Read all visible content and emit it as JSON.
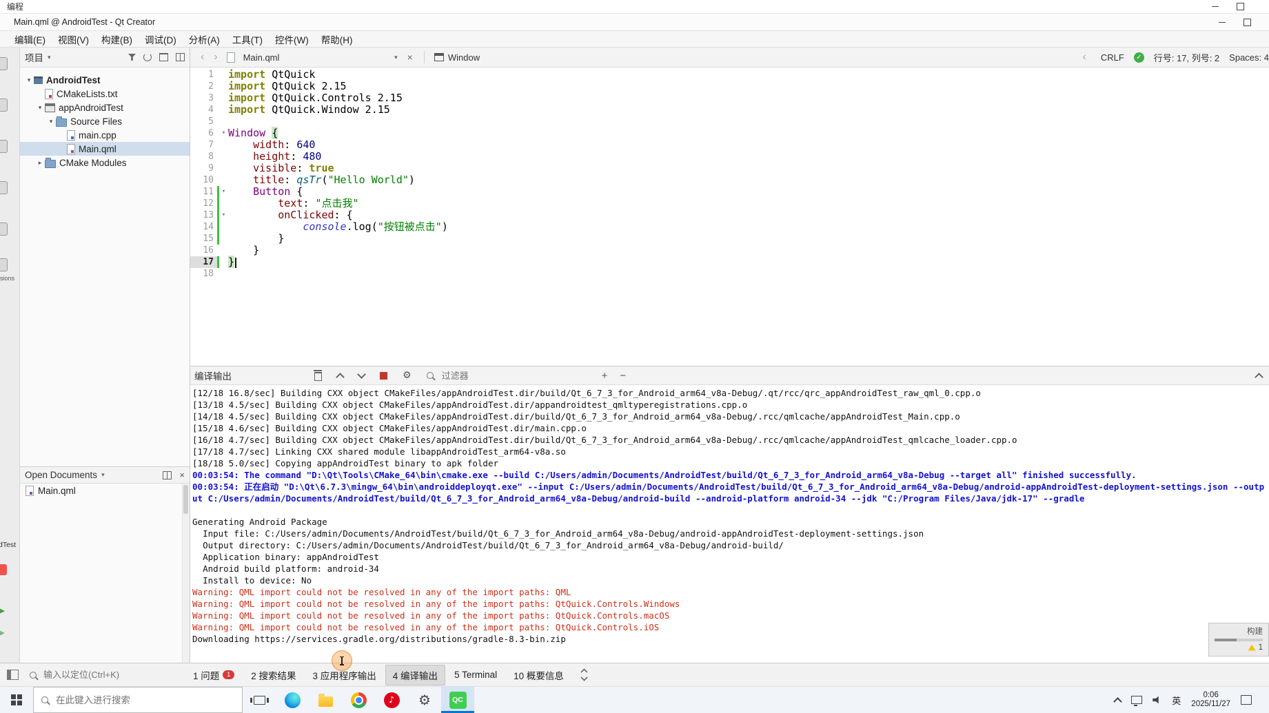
{
  "window": {
    "outer_title": "编程",
    "title": "Main.qml @ AndroidTest - Qt Creator"
  },
  "menu_bar": [
    "编辑(E)",
    "视图(V)",
    "构建(B)",
    "调试(D)",
    "分析(A)",
    "工具(T)",
    "控件(W)",
    "帮助(H)"
  ],
  "mode_strip": {
    "extensions_fragment": "sions",
    "kit_fragment": "dTest"
  },
  "project_pane": {
    "header": "项目",
    "tree": [
      {
        "label": "AndroidTest",
        "depth": 0,
        "expander": "v",
        "icon": "project",
        "bold": true
      },
      {
        "label": "CMakeLists.txt",
        "depth": 1,
        "expander": "",
        "icon": "cmake-file"
      },
      {
        "label": "appAndroidTest",
        "depth": 1,
        "expander": "v",
        "icon": "app"
      },
      {
        "label": "Source Files",
        "depth": 2,
        "expander": "v",
        "icon": "folder"
      },
      {
        "label": "main.cpp",
        "depth": 3,
        "expander": "",
        "icon": "cpp-file"
      },
      {
        "label": "Main.qml",
        "depth": 3,
        "expander": "",
        "icon": "qml-file",
        "selected": true
      },
      {
        "label": "CMake Modules",
        "depth": 1,
        "expander": ">",
        "icon": "folder"
      }
    ],
    "open_documents": {
      "header": "Open Documents",
      "items": [
        "Main.qml"
      ]
    }
  },
  "editor": {
    "nav": {
      "tab_label": "Main.qml",
      "context_label": "Window"
    },
    "status": {
      "line_ending": "CRLF",
      "cursor_position": "行号: 17, 列号: 2",
      "indent": "Spaces: 4"
    },
    "code": {
      "lines": [
        {
          "n": 1,
          "t": [
            [
              "kw",
              "import"
            ],
            [
              "pl",
              " QtQuick"
            ]
          ]
        },
        {
          "n": 2,
          "t": [
            [
              "kw",
              "import"
            ],
            [
              "pl",
              " QtQuick 2.15"
            ]
          ]
        },
        {
          "n": 3,
          "t": [
            [
              "kw",
              "import"
            ],
            [
              "pl",
              " QtQuick.Controls 2.15"
            ]
          ]
        },
        {
          "n": 4,
          "t": [
            [
              "kw",
              "import"
            ],
            [
              "pl",
              " QtQuick.Window 2.15"
            ]
          ]
        },
        {
          "n": 5,
          "t": []
        },
        {
          "n": 6,
          "t": [
            [
              "ty",
              "Window"
            ],
            [
              "pl",
              " "
            ],
            [
              "mb",
              "{"
            ]
          ],
          "fold": true
        },
        {
          "n": 7,
          "t": [
            [
              "pl",
              "    "
            ],
            [
              "pr",
              "width"
            ],
            [
              "pl",
              ": "
            ],
            [
              "nu",
              "640"
            ]
          ]
        },
        {
          "n": 8,
          "t": [
            [
              "pl",
              "    "
            ],
            [
              "pr",
              "height"
            ],
            [
              "pl",
              ": "
            ],
            [
              "nu",
              "480"
            ]
          ]
        },
        {
          "n": 9,
          "t": [
            [
              "pl",
              "    "
            ],
            [
              "pr",
              "visible"
            ],
            [
              "pl",
              ": "
            ],
            [
              "kw",
              "true"
            ]
          ]
        },
        {
          "n": 10,
          "t": [
            [
              "pl",
              "    "
            ],
            [
              "pr",
              "title"
            ],
            [
              "pl",
              ": "
            ],
            [
              "fn",
              "qsTr"
            ],
            [
              "pl",
              "("
            ],
            [
              "st",
              "\"Hello World\""
            ],
            [
              "pl",
              ")"
            ]
          ]
        },
        {
          "n": 11,
          "t": [
            [
              "pl",
              "    "
            ],
            [
              "ty",
              "Button"
            ],
            [
              "pl",
              " {"
            ]
          ],
          "fold": true,
          "chg": true
        },
        {
          "n": 12,
          "t": [
            [
              "pl",
              "        "
            ],
            [
              "pr",
              "text"
            ],
            [
              "pl",
              ": "
            ],
            [
              "st",
              "\"点击我\""
            ]
          ],
          "chg": true
        },
        {
          "n": 13,
          "t": [
            [
              "pl",
              "        "
            ],
            [
              "pr",
              "onClicked"
            ],
            [
              "pl",
              ": {"
            ]
          ],
          "fold": true,
          "chg": true
        },
        {
          "n": 14,
          "t": [
            [
              "pl",
              "            "
            ],
            [
              "vi",
              "console"
            ],
            [
              "pl",
              ".log("
            ],
            [
              "st",
              "\"按钮被点击\""
            ],
            [
              "pl",
              ")"
            ]
          ],
          "chg": true
        },
        {
          "n": 15,
          "t": [
            [
              "pl",
              "        }"
            ]
          ],
          "chg": true
        },
        {
          "n": 16,
          "t": [
            [
              "pl",
              "    }"
            ]
          ]
        },
        {
          "n": 17,
          "t": [
            [
              "mb",
              "}"
            ]
          ],
          "chg": true,
          "cur": true
        },
        {
          "n": 18,
          "t": []
        }
      ]
    }
  },
  "output_pane": {
    "title": "编译输出",
    "filter_placeholder": "过滤器",
    "lines": [
      {
        "c": "std",
        "t": "[12/18 16.8/sec] Building CXX object CMakeFiles/appAndroidTest.dir/build/Qt_6_7_3_for_Android_arm64_v8a-Debug/.qt/rcc/qrc_appAndroidTest_raw_qml_0.cpp.o"
      },
      {
        "c": "std",
        "t": "[13/18 4.5/sec] Building CXX object CMakeFiles/appAndroidTest.dir/appandroidtest_qmltyperegistrations.cpp.o"
      },
      {
        "c": "std",
        "t": "[14/18 4.5/sec] Building CXX object CMakeFiles/appAndroidTest.dir/build/Qt_6_7_3_for_Android_arm64_v8a-Debug/.rcc/qmlcache/appAndroidTest_Main.cpp.o"
      },
      {
        "c": "std",
        "t": "[15/18 4.6/sec] Building CXX object CMakeFiles/appAndroidTest.dir/main.cpp.o"
      },
      {
        "c": "std",
        "t": "[16/18 4.7/sec] Building CXX object CMakeFiles/appAndroidTest.dir/build/Qt_6_7_3_for_Android_arm64_v8a-Debug/.rcc/qmlcache/appAndroidTest_qmlcache_loader.cpp.o"
      },
      {
        "c": "std",
        "t": "[17/18 4.7/sec] Linking CXX shared module libappAndroidTest_arm64-v8a.so"
      },
      {
        "c": "std",
        "t": "[18/18 5.0/sec] Copying appAndroidTest binary to apk folder"
      },
      {
        "c": "msg",
        "t": "00:03:54: The command \"D:\\Qt\\Tools\\CMake_64\\bin\\cmake.exe --build C:/Users/admin/Documents/AndroidTest/build/Qt_6_7_3_for_Android_arm64_v8a-Debug --target all\" finished successfully."
      },
      {
        "c": "msg",
        "t": "00:03:54: 正在启动 \"D:\\Qt\\6.7.3\\mingw_64\\bin\\androiddeployqt.exe\" --input C:/Users/admin/Documents/AndroidTest/build/Qt_6_7_3_for_Android_arm64_v8a-Debug/android-appAndroidTest-deployment-settings.json --output C:/Users/admin/Documents/AndroidTest/build/Qt_6_7_3_for_Android_arm64_v8a-Debug/android-build --android-platform android-34 --jdk \"C:/Program Files/Java/jdk-17\" --gradle"
      },
      {
        "c": "std",
        "t": ""
      },
      {
        "c": "std",
        "t": "Generating Android Package"
      },
      {
        "c": "std",
        "t": "  Input file: C:/Users/admin/Documents/AndroidTest/build/Qt_6_7_3_for_Android_arm64_v8a-Debug/android-appAndroidTest-deployment-settings.json"
      },
      {
        "c": "std",
        "t": "  Output directory: C:/Users/admin/Documents/AndroidTest/build/Qt_6_7_3_for_Android_arm64_v8a-Debug/android-build/"
      },
      {
        "c": "std",
        "t": "  Application binary: appAndroidTest"
      },
      {
        "c": "std",
        "t": "  Android build platform: android-34"
      },
      {
        "c": "std",
        "t": "  Install to device: No"
      },
      {
        "c": "warn",
        "t": "Warning: QML import could not be resolved in any of the import paths: QML"
      },
      {
        "c": "warn",
        "t": "Warning: QML import could not be resolved in any of the import paths: QtQuick.Controls.Windows"
      },
      {
        "c": "warn",
        "t": "Warning: QML import could not be resolved in any of the import paths: QtQuick.Controls.macOS"
      },
      {
        "c": "warn",
        "t": "Warning: QML import could not be resolved in any of the import paths: QtQuick.Controls.iOS"
      },
      {
        "c": "std",
        "t": "Downloading https://services.gradle.org/distributions/gradle-8.3-bin.zip"
      }
    ]
  },
  "status_bar": {
    "locator_placeholder": "输入以定位(Ctrl+K)",
    "panels": [
      {
        "label": "1 问题",
        "badge": "1"
      },
      {
        "label": "2 搜索结果"
      },
      {
        "label": "3 应用程序输出"
      },
      {
        "label": "4 编译输出",
        "active": true
      },
      {
        "label": "5 Terminal"
      },
      {
        "label": "10 概要信息"
      }
    ]
  },
  "build_popup": {
    "label": "构建",
    "warning_count": "1"
  },
  "taskbar": {
    "search_placeholder": "在此键入进行搜索",
    "apps": [
      {
        "name": "task-view"
      },
      {
        "name": "edge"
      },
      {
        "name": "explorer"
      },
      {
        "name": "chrome"
      },
      {
        "name": "music",
        "glyph": "♪"
      },
      {
        "name": "settings",
        "glyph": "⚙"
      },
      {
        "name": "qt-creator",
        "text": "QC",
        "active": true
      }
    ],
    "tray": {
      "lang": "英",
      "time": "0:06",
      "date": "2025/11/27"
    }
  }
}
